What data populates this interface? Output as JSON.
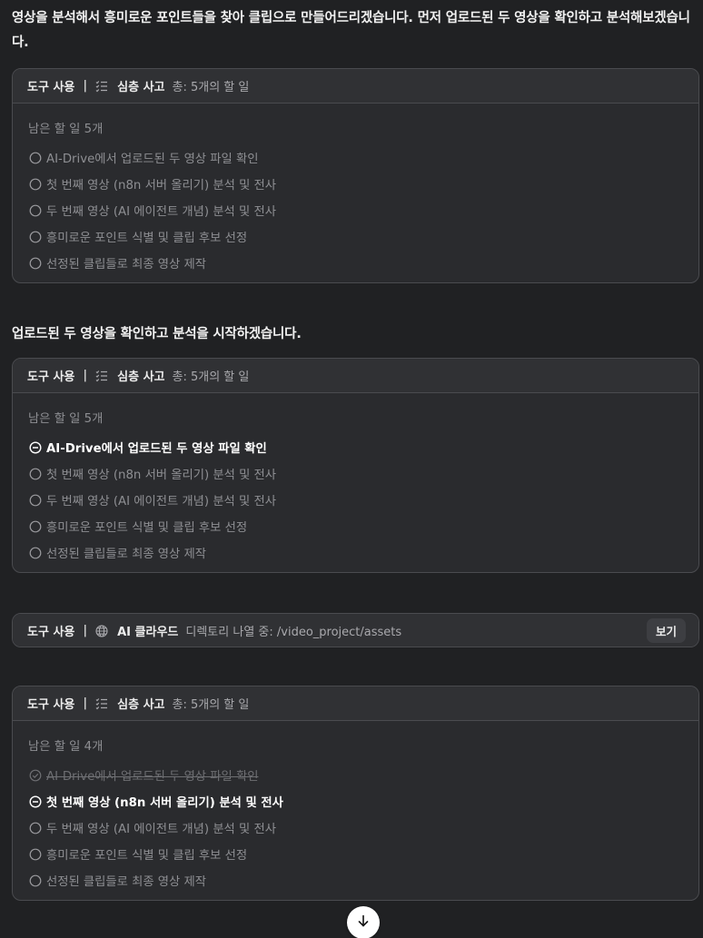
{
  "messages": {
    "intro": "영상을 분석해서 흥미로운 포인트들을 찾아 클립으로 만들어드리겠습니다. 먼저 업로드된 두 영상을 확인하고 분석해보겠습니다.",
    "start": "업로드된 두 영상을 확인하고 분석을 시작하겠습니다."
  },
  "cards": [
    {
      "tool_label": "도구 사용",
      "separator": "|",
      "icon": "checklist-icon",
      "name": "심층 사고",
      "description": "총: 5개의 할 일",
      "remaining": "남은 할 일 5개",
      "todos": [
        {
          "text": "AI-Drive에서 업로드된 두 영상 파일 확인",
          "status": "pending"
        },
        {
          "text": "첫 번째 영상 (n8n 서버 올리기) 분석 및 전사",
          "status": "pending"
        },
        {
          "text": "두 번째 영상 (AI 에이전트 개념) 분석 및 전사",
          "status": "pending"
        },
        {
          "text": "흥미로운 포인트 식별 및 클립 후보 선정",
          "status": "pending"
        },
        {
          "text": "선정된 클립들로 최종 영상 제작",
          "status": "pending"
        }
      ]
    },
    {
      "tool_label": "도구 사용",
      "separator": "|",
      "icon": "checklist-icon",
      "name": "심층 사고",
      "description": "총: 5개의 할 일",
      "remaining": "남은 할 일 5개",
      "todos": [
        {
          "text": "AI-Drive에서 업로드된 두 영상 파일 확인",
          "status": "active"
        },
        {
          "text": "첫 번째 영상 (n8n 서버 올리기) 분석 및 전사",
          "status": "pending"
        },
        {
          "text": "두 번째 영상 (AI 에이전트 개념) 분석 및 전사",
          "status": "pending"
        },
        {
          "text": "흥미로운 포인트 식별 및 클립 후보 선정",
          "status": "pending"
        },
        {
          "text": "선정된 클립들로 최종 영상 제작",
          "status": "pending"
        }
      ]
    },
    {
      "tool_label": "도구 사용",
      "separator": "|",
      "icon": "globe-icon",
      "name": "AI 클라우드",
      "description": "디렉토리 나열 중: /video_project/assets",
      "view_label": "보기"
    },
    {
      "tool_label": "도구 사용",
      "separator": "|",
      "icon": "checklist-icon",
      "name": "심층 사고",
      "description": "총: 5개의 할 일",
      "remaining": "남은 할 일 4개",
      "todos": [
        {
          "text": "AI-Drive에서 업로드된 두 영상 파일 확인",
          "status": "done"
        },
        {
          "text": "첫 번째 영상 (n8n 서버 올리기) 분석 및 전사",
          "status": "active"
        },
        {
          "text": "두 번째 영상 (AI 에이전트 개념) 분석 및 전사",
          "status": "pending"
        },
        {
          "text": "흥미로운 포인트 식별 및 클립 후보 선정",
          "status": "pending"
        },
        {
          "text": "선정된 클립들로 최종 영상 제작",
          "status": "pending"
        }
      ]
    }
  ],
  "scroll_button": {
    "icon": "arrow-down-icon"
  }
}
